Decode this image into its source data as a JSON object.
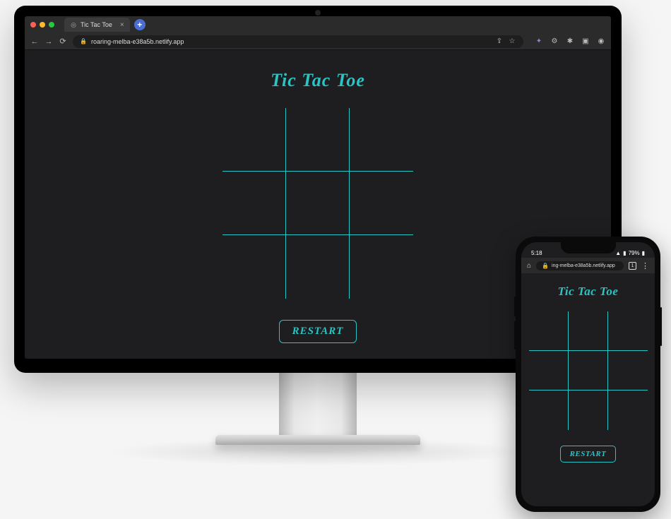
{
  "desktop": {
    "browser": {
      "tab_title": "Tic Tac Toe",
      "url": "roaring-melba-e38a5b.netlify.app",
      "new_tab_label": "+"
    },
    "app": {
      "title": "Tic Tac Toe",
      "restart_label": "RESTART",
      "board": [
        "",
        "",
        "",
        "",
        "",
        "",
        "",
        "",
        ""
      ]
    }
  },
  "phone": {
    "status": {
      "time": "5:18",
      "battery_text": "79%"
    },
    "browser": {
      "url": "ing-melba-e38a5b.netlify.app",
      "tabs_count": "1"
    },
    "app": {
      "title": "Tic Tac Toe",
      "restart_label": "RESTART",
      "board": [
        "",
        "",
        "",
        "",
        "",
        "",
        "",
        "",
        ""
      ]
    }
  },
  "colors": {
    "accent": "#2bc4c4",
    "bg": "#1e1e21"
  }
}
